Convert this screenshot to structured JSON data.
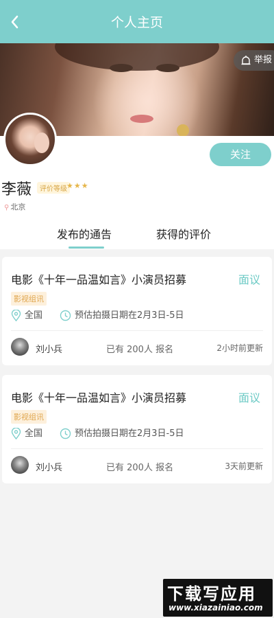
{
  "header": {
    "title": "个人主页"
  },
  "cover": {
    "report_label": "举报"
  },
  "profile": {
    "name": "李薇",
    "rating_label": "评价等级",
    "rating_stars": "★★★",
    "rating": 3,
    "location": "北京",
    "follow_label": "关注"
  },
  "tabs": [
    {
      "label": "发布的通告",
      "active": true
    },
    {
      "label": "获得的评价",
      "active": false
    }
  ],
  "posts": [
    {
      "title": "电影《十年一品温如言》小演员招募",
      "price": "面议",
      "tag": "影视组讯",
      "location": "全国",
      "date": "预估拍摄日期在2月3日-5日",
      "user": "刘小兵",
      "signup": "已有 200人 报名",
      "updated": "2小时前更新"
    },
    {
      "title": "电影《十年一品温如言》小演员招募",
      "price": "面议",
      "tag": "影视组讯",
      "location": "全国",
      "date": "预估拍摄日期在2月3日-5日",
      "user": "刘小兵",
      "signup": "已有 200人 报名",
      "updated": "3天前更新"
    }
  ],
  "watermark": {
    "line1": "下载写应用",
    "line2": "www.xiazainiao.com"
  },
  "colors": {
    "accent": "#7ecfcc",
    "tag_text": "#e0a64e",
    "star": "#e6b64a"
  },
  "icons": {
    "back": "chevron-left-icon",
    "report": "alert-bell-icon",
    "location": "map-pin-icon",
    "clock": "clock-icon"
  }
}
